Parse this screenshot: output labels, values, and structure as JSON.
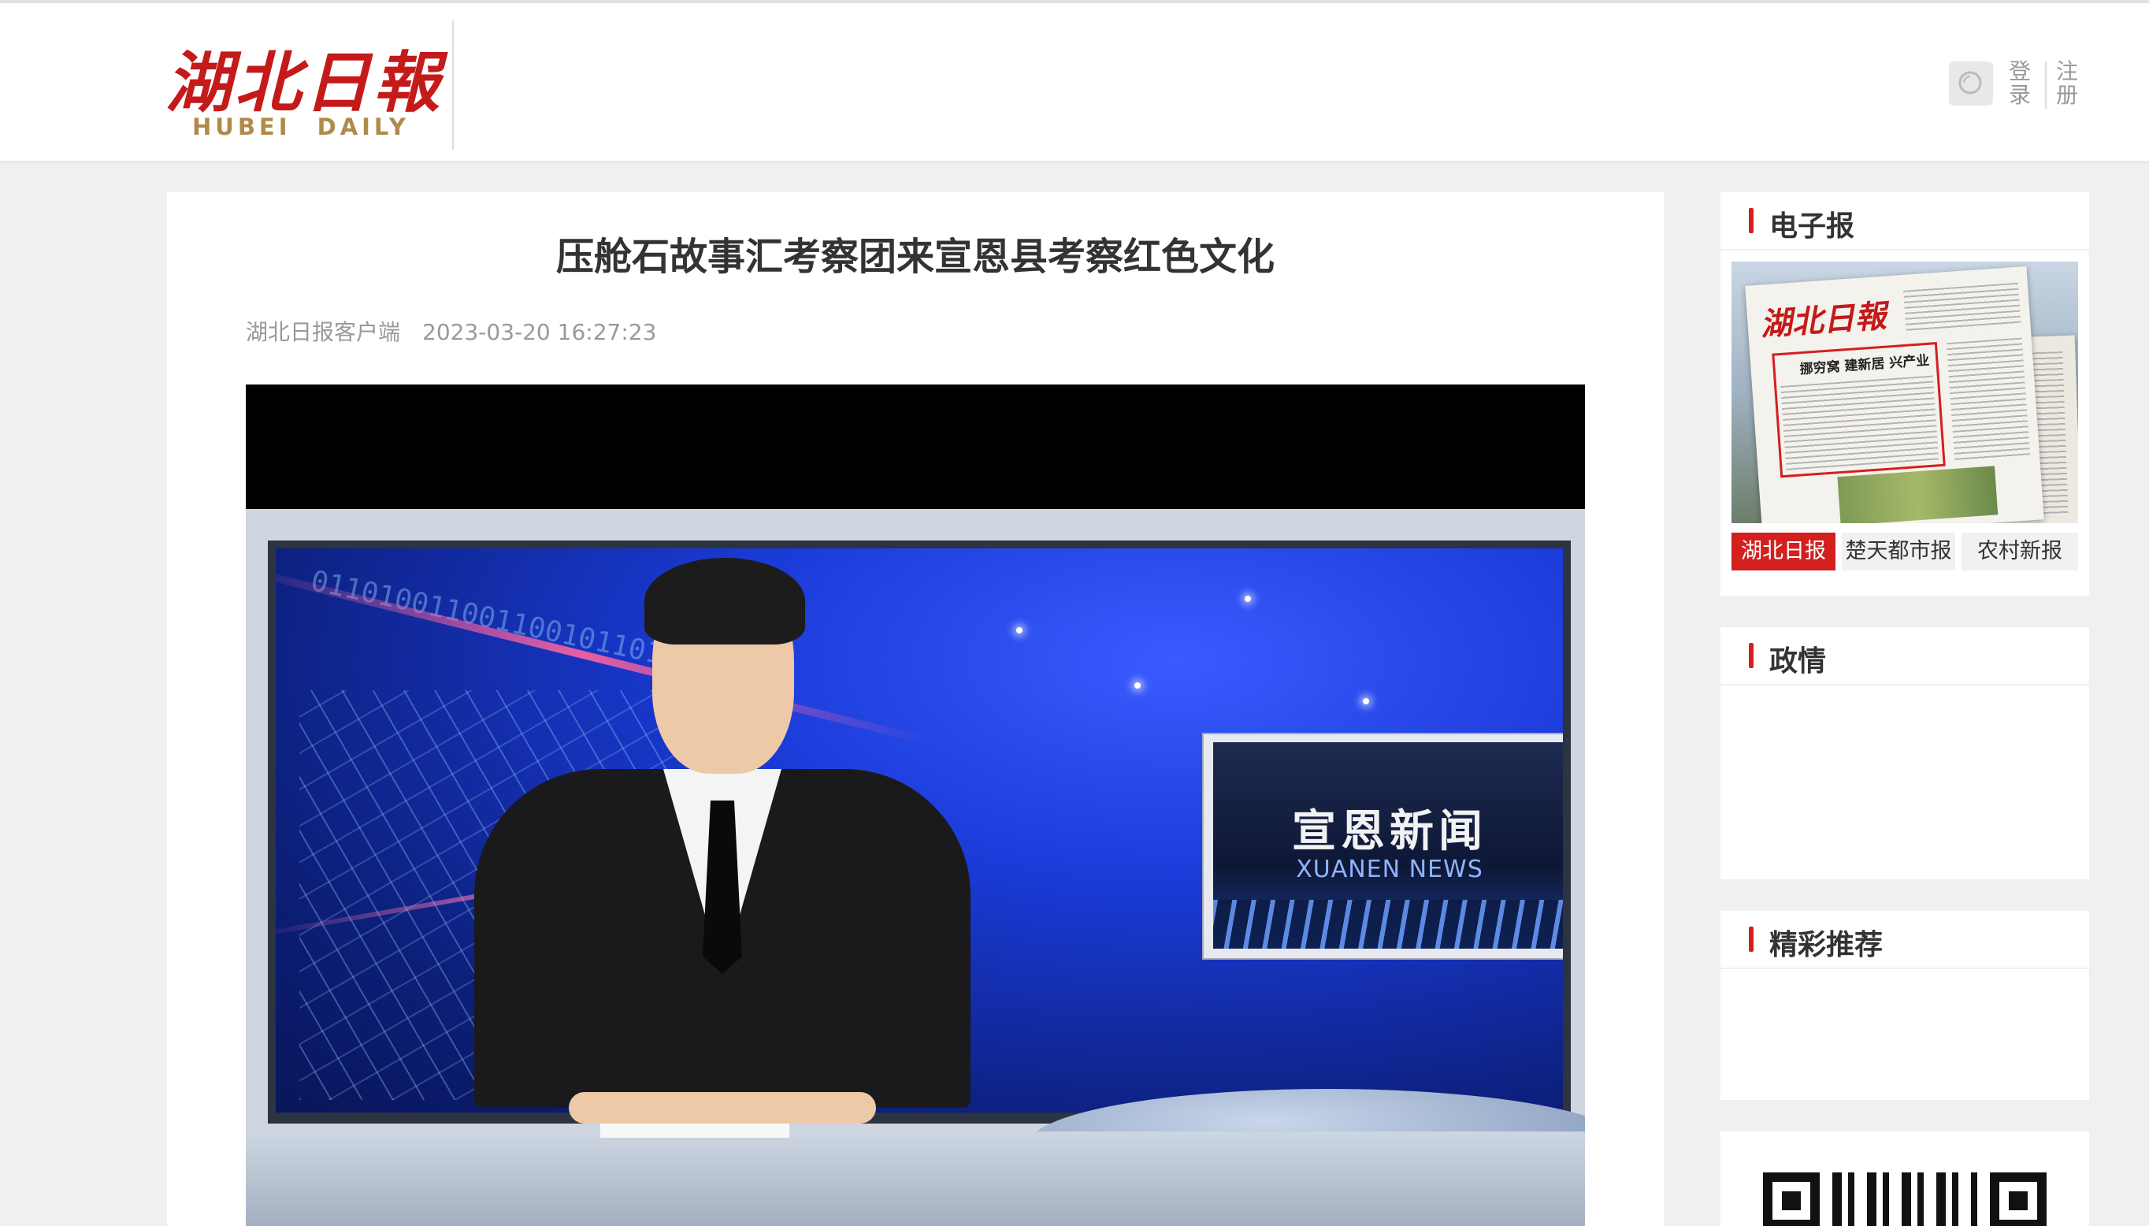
{
  "header": {
    "logo_cn": "湖北日報",
    "logo_en": "HUBEI DAILY",
    "login_label": "登录",
    "register_label": "注册"
  },
  "article": {
    "title": "压舱石故事汇考察团来宣恩县考察红色文化",
    "source": "湖北日报客户端",
    "datetime": "2023-03-20 16:27:23",
    "video": {
      "panel_title_cn": "宣恩新闻",
      "panel_title_en": "XUANEN NEWS",
      "binary_text": "0110100110011001011010"
    }
  },
  "sidebar": {
    "epaper": {
      "title": "电子报",
      "cover_logo": "湖北日報",
      "cover_headline": "挪穷窝 建新居 兴产业",
      "tabs": [
        {
          "label": "湖北日报",
          "active": true
        },
        {
          "label": "楚天都市报",
          "active": false
        },
        {
          "label": "农村新报",
          "active": false
        }
      ]
    },
    "politics": {
      "title": "政情"
    },
    "recommend": {
      "title": "精彩推荐"
    }
  },
  "colors": {
    "brand_red": "#d3201f",
    "logo_gold": "#b08a4a",
    "background": "#f0f0f0"
  }
}
